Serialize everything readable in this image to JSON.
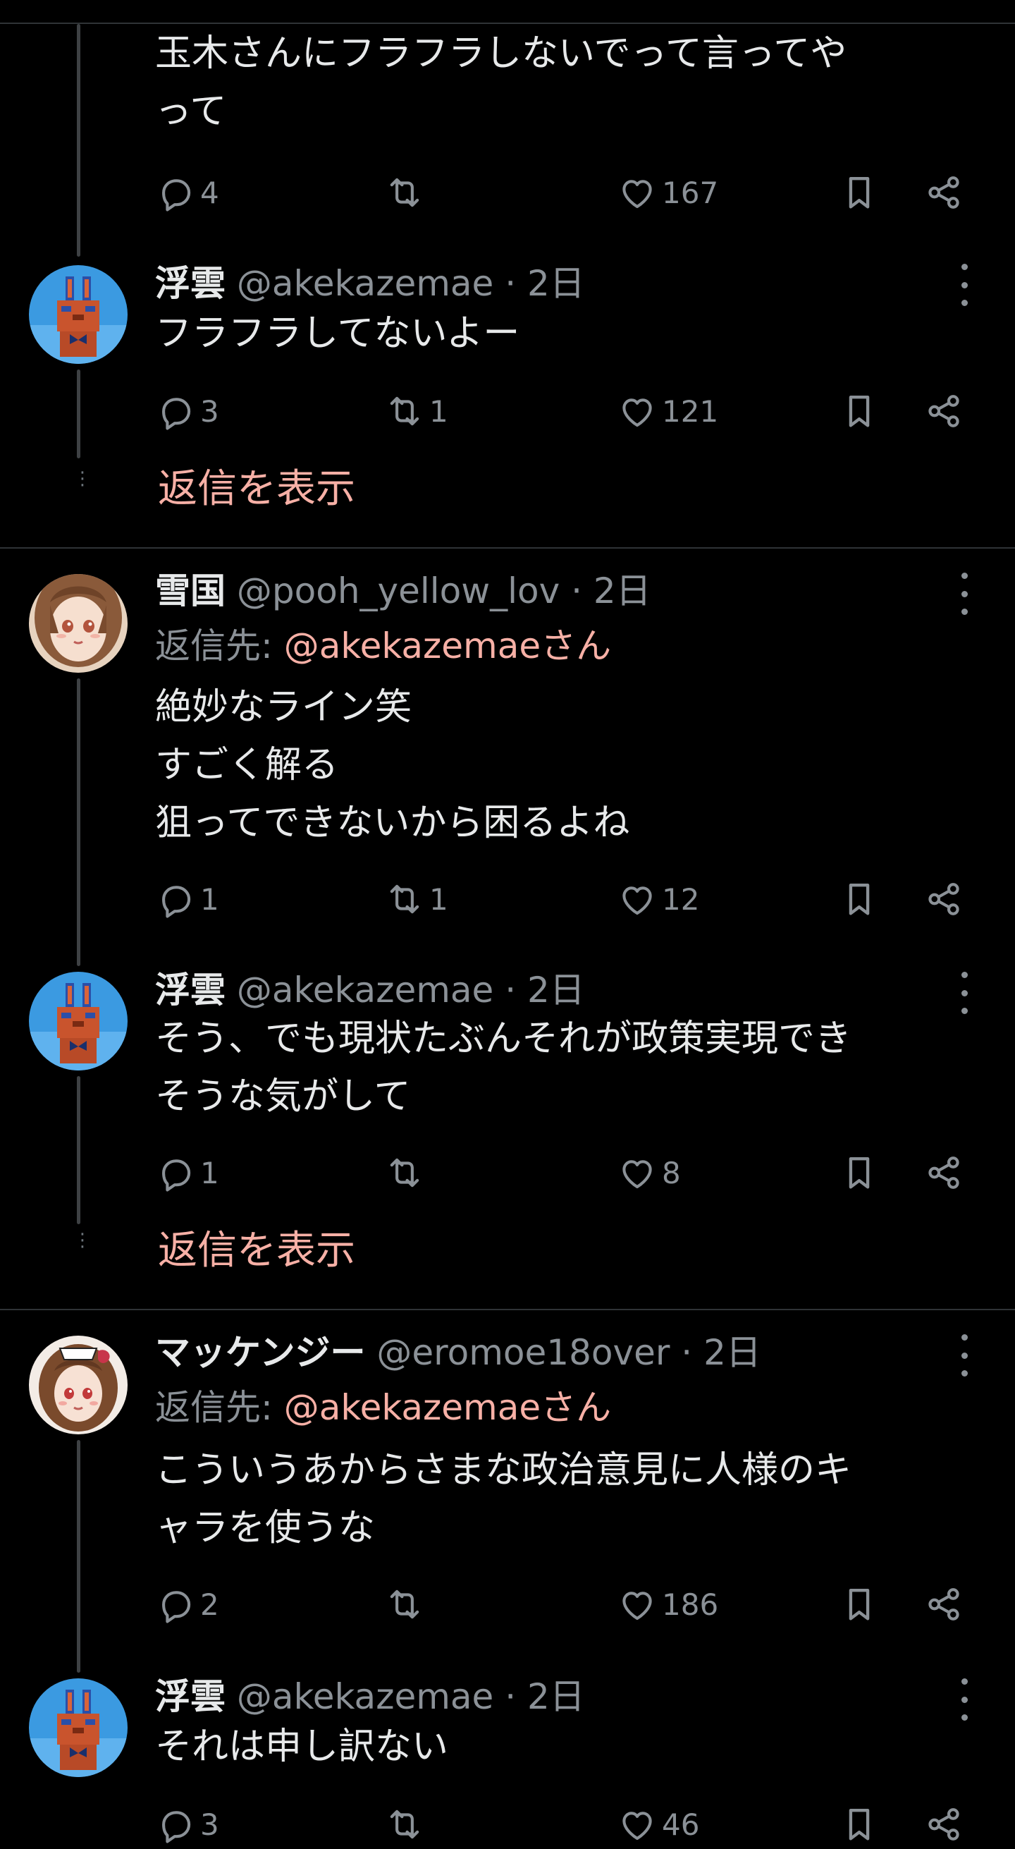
{
  "colors": {
    "background": "#000000",
    "text": "#e7e9ea",
    "muted": "#8b9197",
    "accent": "#f7b0a6",
    "divider": "#2f3336"
  },
  "show_replies_label": "返信を表示",
  "posts": [
    {
      "text": "玉木さんにフラフラしないでって言ってや\nって",
      "counts": {
        "replies": "4",
        "reposts": "",
        "likes": "167"
      }
    },
    {
      "name": "浮雲",
      "handle": "@akekazemae",
      "sep": " · ",
      "time": "2日",
      "text": "フラフラしてないよー",
      "counts": {
        "replies": "3",
        "reposts": "1",
        "likes": "121"
      },
      "avatar": "bunny-avatar"
    },
    {
      "name": "雪国",
      "handle": "@pooh_yellow_lov",
      "sep": " · ",
      "time": "2日",
      "reply_to_prefix": "返信先: ",
      "reply_to_mention": "@akekazemaeさん",
      "text": "絶妙なライン笑\nすごく解る\n狙ってできないから困るよね",
      "counts": {
        "replies": "1",
        "reposts": "1",
        "likes": "12"
      },
      "avatar": "anime-girl-avatar"
    },
    {
      "name": "浮雲",
      "handle": "@akekazemae",
      "sep": " · ",
      "time": "2日",
      "text": "そう、でも現状たぶんそれが政策実現でき\nそうな気がして",
      "counts": {
        "replies": "1",
        "reposts": "",
        "likes": "8"
      },
      "avatar": "bunny-avatar"
    },
    {
      "name": "マッケンジー",
      "handle": "@eromoe18over",
      "sep": " · ",
      "time": "2日",
      "reply_to_prefix": "返信先: ",
      "reply_to_mention": "@akekazemaeさん",
      "text": "こういうあからさまな政治意見に人様のキ\nャラを使うな",
      "counts": {
        "replies": "2",
        "reposts": "",
        "likes": "186"
      },
      "avatar": "maid-girl-avatar"
    },
    {
      "name": "浮雲",
      "handle": "@akekazemae",
      "sep": " · ",
      "time": "2日",
      "text": "それは申し訳ない",
      "counts": {
        "replies": "3",
        "reposts": "",
        "likes": "46"
      },
      "avatar": "bunny-avatar"
    }
  ]
}
